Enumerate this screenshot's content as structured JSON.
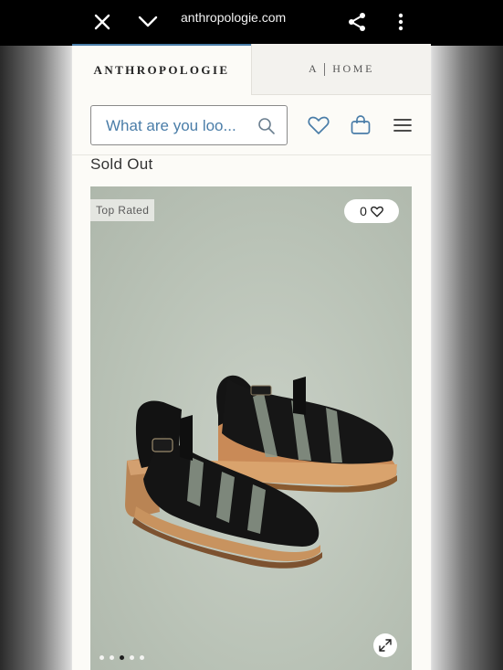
{
  "browser": {
    "url": "anthropologie.com",
    "icons": [
      "close-icon",
      "chevron-down-icon",
      "share-icon",
      "more-vert-icon"
    ]
  },
  "brand_tabs": {
    "primary": "ANTHROPOLOGIE",
    "secondary_mark": "A",
    "secondary": "HOME"
  },
  "header": {
    "search_placeholder": "What are you loo...",
    "icons": [
      "search-icon",
      "heart-icon",
      "bag-icon",
      "menu-icon"
    ]
  },
  "product": {
    "status": "Sold Out",
    "badge": "Top Rated",
    "likes_count": "0",
    "carousel": {
      "total": 5,
      "active_index": 2
    }
  },
  "colors": {
    "accent": "#4a7da8",
    "page_bg": "#fcfbf7",
    "image_bg": "#bac3b7"
  }
}
